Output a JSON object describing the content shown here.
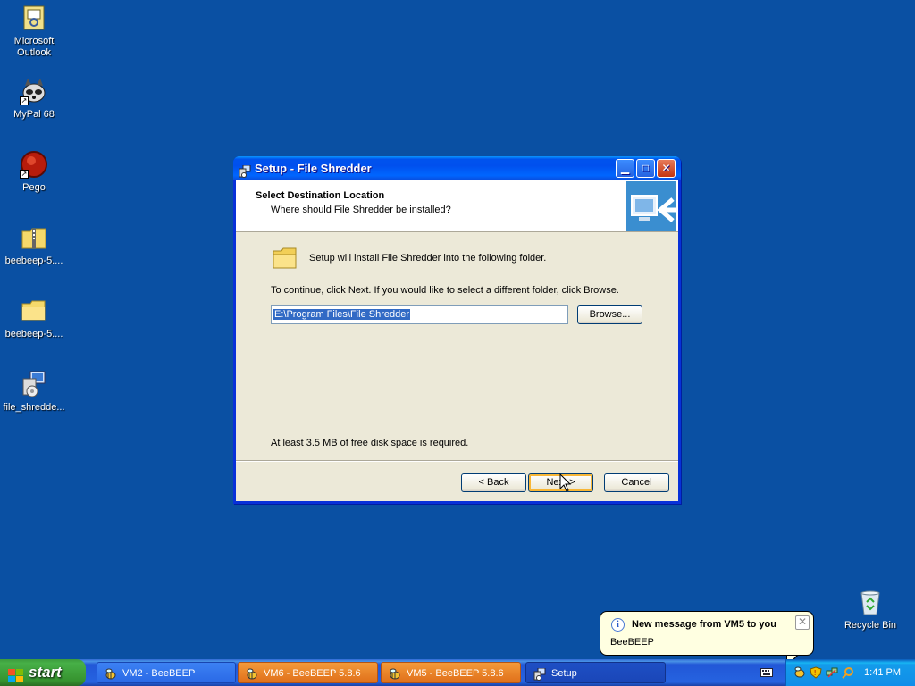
{
  "desktop": {
    "icons": [
      {
        "label": "Microsoft Outlook",
        "icon": "outlook-icon"
      },
      {
        "label": "MyPal 68",
        "icon": "raccoon-icon"
      },
      {
        "label": "Pego",
        "icon": "pego-icon"
      },
      {
        "label": "beebeep-5....",
        "icon": "zip-folder-icon"
      },
      {
        "label": "beebeep-5....",
        "icon": "folder-icon"
      },
      {
        "label": "file_shredde...",
        "icon": "installer-icon"
      },
      {
        "label": "Recycle Bin",
        "icon": "recycle-bin-icon"
      }
    ]
  },
  "window": {
    "title": "Setup - File Shredder",
    "header_title": "Select Destination Location",
    "header_subtitle": "Where should File Shredder be installed?",
    "install_text": "Setup will install File Shredder into the following folder.",
    "continue_text": "To continue, click Next. If you would like to select a different folder, click Browse.",
    "path_value": "E:\\Program Files\\File Shredder",
    "browse_label": "Browse...",
    "disk_space_text": "At least 3.5 MB of free disk space is required.",
    "back_label": "< Back",
    "next_label": "Next >",
    "cancel_label": "Cancel"
  },
  "taskbar": {
    "start_label": "start",
    "tasks": [
      {
        "label": "VM2 - BeeBEEP"
      },
      {
        "label": "VM6 - BeeBEEP 5.8.6"
      },
      {
        "label": "VM5 - BeeBEEP 5.8.6"
      },
      {
        "label": "Setup"
      }
    ],
    "clock": "1:41 PM"
  },
  "balloon": {
    "title": "New message from VM5 to you",
    "body": "BeeBEEP"
  },
  "colors": {
    "desktop": "#0a50a3",
    "title_bar": "#0053ee",
    "task_orange": "#e0701a",
    "selection": "#316ac5"
  }
}
